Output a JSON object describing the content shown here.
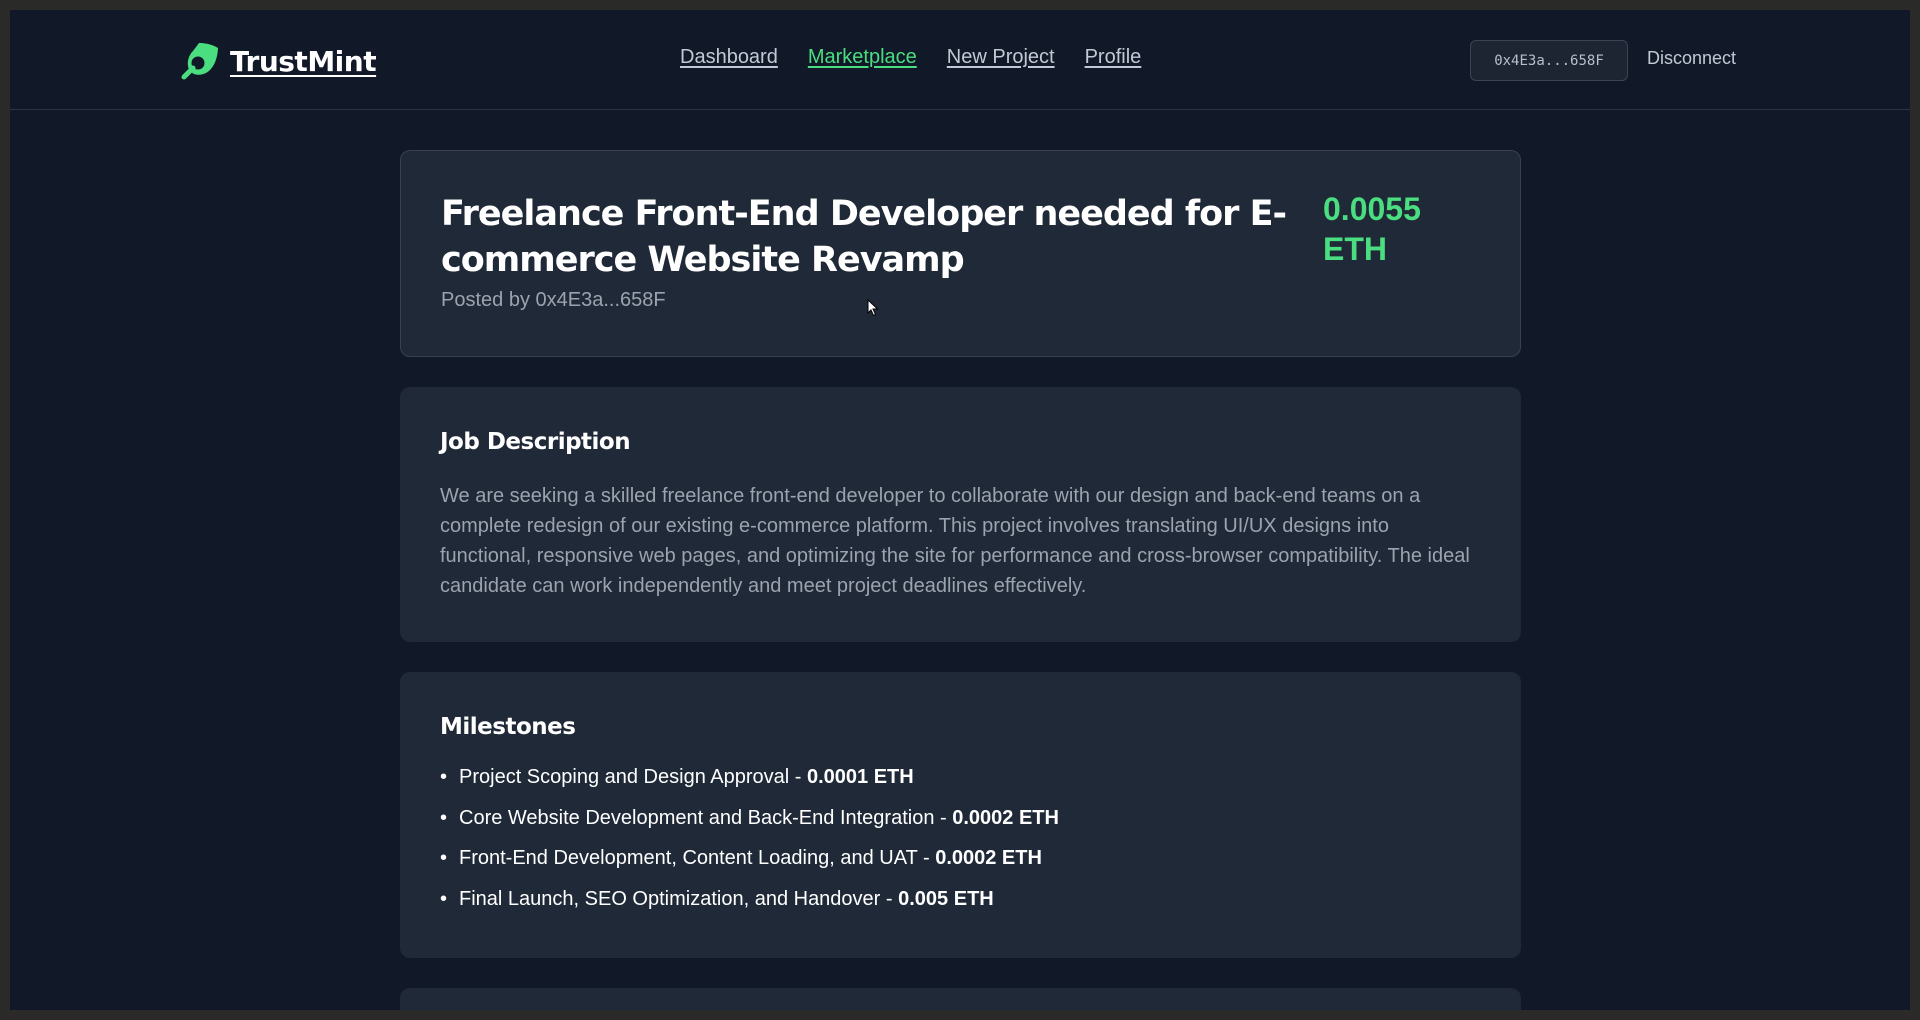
{
  "header": {
    "brand": "TrustMint",
    "nav": [
      {
        "label": "Dashboard",
        "active": false
      },
      {
        "label": "Marketplace",
        "active": true
      },
      {
        "label": "New Project",
        "active": false
      },
      {
        "label": "Profile",
        "active": false
      }
    ],
    "wallet_address": "0x4E3a...658F",
    "disconnect_label": "Disconnect"
  },
  "project": {
    "title": "Freelance Front-End Developer needed for E-commerce Website Revamp",
    "posted_by": "Posted by 0x4E3a...658F",
    "budget": "0.0055 ETH"
  },
  "description": {
    "heading": "Job Description",
    "text": "We are seeking a skilled freelance front-end developer to collaborate with our design and back-end teams on a complete redesign of our existing e-commerce platform. This project involves translating UI/UX designs into functional, responsive web pages, and optimizing the site for performance and cross-browser compatibility. The ideal candidate can work independently and meet project deadlines effectively."
  },
  "milestones": {
    "heading": "Milestones",
    "items": [
      {
        "name": "Project Scoping and Design Approval - ",
        "amount": "0.0001 ETH"
      },
      {
        "name": "Core Website Development and Back-End Integration - ",
        "amount": "0.0002 ETH"
      },
      {
        "name": "Front-End Development, Content Loading, and UAT - ",
        "amount": "0.0002 ETH"
      },
      {
        "name": "Final Launch, SEO Optimization, and Handover - ",
        "amount": "0.005 ETH"
      }
    ]
  },
  "colors": {
    "accent": "#4ade80",
    "background": "#111827",
    "card": "#1f2937"
  },
  "icons": {
    "logo": "leaf-magnifier-logo-icon",
    "cursor": "mouse-pointer-icon"
  }
}
